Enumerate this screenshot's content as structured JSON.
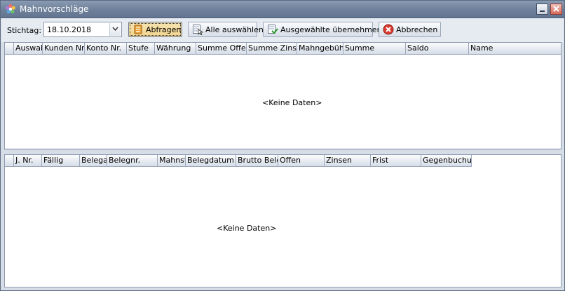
{
  "window": {
    "title": "Mahnvorschläge"
  },
  "toolbar": {
    "stichtag_label": "Stichtag:",
    "stichtag_value": "18.10.2018",
    "abfragen_label": "Abfragen",
    "alle_auswaehlen_label": "Alle auswählen",
    "ausgewaehlte_uebernehmen_label": "Ausgewählte übernehmen",
    "abbrechen_label": "Abbrechen"
  },
  "top_grid": {
    "columns": [
      "Auswahl",
      "Kunden Nr.",
      "Konto Nr.",
      "Stufe",
      "Währung",
      "Summe Offen",
      "Summe Zinsen",
      "Mahngebühr",
      "Summe",
      "Saldo",
      "Name"
    ],
    "empty_text": "<Keine Daten>"
  },
  "bottom_grid": {
    "columns": [
      "J. Nr.",
      "Fällig",
      "Belegart",
      "Belegnr.",
      "Mahnstufe",
      "Belegdatum",
      "Brutto Beleg",
      "Offen",
      "Zinsen",
      "Frist",
      "Gegenbuchung"
    ],
    "empty_text": "<Keine Daten>"
  },
  "colors": {
    "titlebar": "#6d7f99",
    "toolbar": "#e6ebf2",
    "active_button": "#f2d48f",
    "close_button": "#d9685a"
  },
  "icons": [
    "flower-app-icon",
    "minimize-icon",
    "close-icon",
    "chevron-down-icon",
    "database-query-icon",
    "select-all-icon",
    "apply-selected-icon",
    "cancel-icon"
  ]
}
